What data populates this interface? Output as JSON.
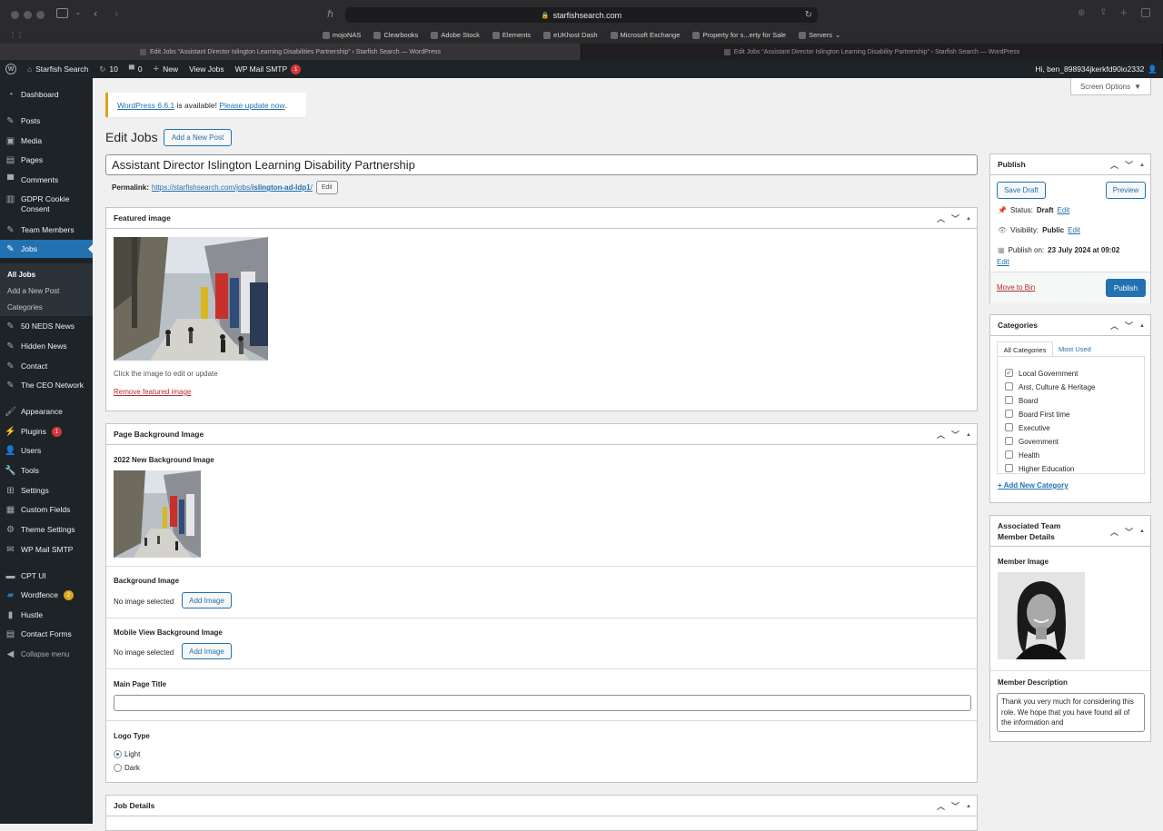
{
  "browser": {
    "url": "starfishsearch.com",
    "bookmarks": [
      "mojoNAS",
      "Clearbooks",
      "Adobe Stock",
      "Elements",
      "eUKhost Dash",
      "Microsoft Exchange",
      "Property for s...erty for Sale",
      "Servers"
    ],
    "tabs": [
      "Edit Jobs “Assistant Director Islington Learning Disabilities Partnership” ‹ Starfish Search — WordPress",
      "Edit Jobs “Assistant Director Islington Learning Disability Partnership” ‹ Starfish Search — WordPress"
    ]
  },
  "adminbar": {
    "site": "Starfish Search",
    "updates": "10",
    "comments": "0",
    "new": "New",
    "view_jobs": "View Jobs",
    "smtp": "WP Mail SMTP",
    "smtp_badge": "1",
    "greeting": "Hi, ben_898934jkerkfd90io2332"
  },
  "sidebar": {
    "items": [
      "Dashboard",
      "Posts",
      "Media",
      "Pages",
      "Comments",
      "GDPR Cookie Consent",
      "Team Members",
      "Jobs",
      "50 NEDS News",
      "Hidden News",
      "Contact",
      "The CEO Network",
      "Appearance",
      "Plugins",
      "Users",
      "Tools",
      "Settings",
      "Custom Fields",
      "Theme Settings",
      "WP Mail SMTP",
      "CPT UI",
      "Wordfence",
      "Hustle",
      "Contact Forms",
      "Collapse menu"
    ],
    "plugins_badge": "1",
    "wordfence_badge": "2",
    "submenu": [
      "All Jobs",
      "Add a New Post",
      "Categories"
    ]
  },
  "screen_options": "Screen Options",
  "notice": {
    "version_link": "WordPress 6.6.1",
    "mid": " is available! ",
    "update_link": "Please update now",
    "end": "."
  },
  "page": {
    "heading": "Edit Jobs",
    "add_new": "Add a New Post",
    "title_value": "Assistant Director Islington Learning Disability Partnership",
    "permalink_label": "Permalink:",
    "permalink_base": "https://starfishsearch.com/jobs/",
    "permalink_slug": "islington-ad-ldp1",
    "permalink_tail": "/",
    "edit": "Edit"
  },
  "featured": {
    "title": "Featured image",
    "hint": "Click the image to edit or update",
    "remove": "Remove featured image"
  },
  "bg": {
    "title": "Page Background Image",
    "label_2022": "2022 New Background Image",
    "label_bg": "Background Image",
    "no_image": "No image selected",
    "add_image": "Add Image",
    "label_mobile": "Mobile View Background Image",
    "label_main_title": "Main Page Title",
    "main_title_value": "",
    "label_logo": "Logo Type",
    "logo_options": [
      "Light",
      "Dark"
    ]
  },
  "job_details": {
    "title": "Job Details"
  },
  "publish": {
    "title": "Publish",
    "save_draft": "Save Draft",
    "preview": "Preview",
    "status_label": "Status:",
    "status_value": "Draft",
    "visibility_label": "Visibility:",
    "visibility_value": "Public",
    "publish_on_label": "Publish on:",
    "publish_on_value": "23 July 2024 at 09:02",
    "edit": "Edit",
    "move_to_bin": "Move to Bin",
    "publish_btn": "Publish"
  },
  "categories": {
    "title": "Categories",
    "tab_all": "All Categories",
    "tab_most": "Most Used",
    "items": [
      "Local Government",
      "Arst, Culture & Heritage",
      "Board",
      "Board First time",
      "Executive",
      "Government",
      "Health",
      "Higher Education"
    ],
    "add_new": "+ Add New Category"
  },
  "team": {
    "title": "Associated Team Member Details",
    "member_image": "Member Image",
    "member_desc_label": "Member Description",
    "member_desc": "Thank you very much for considering this role. We hope that you have found all of the information and"
  },
  "colors": {
    "accent": "#2271b1",
    "adminbar": "#1d2327",
    "notice": "#dba617",
    "danger": "#b32d2e"
  }
}
